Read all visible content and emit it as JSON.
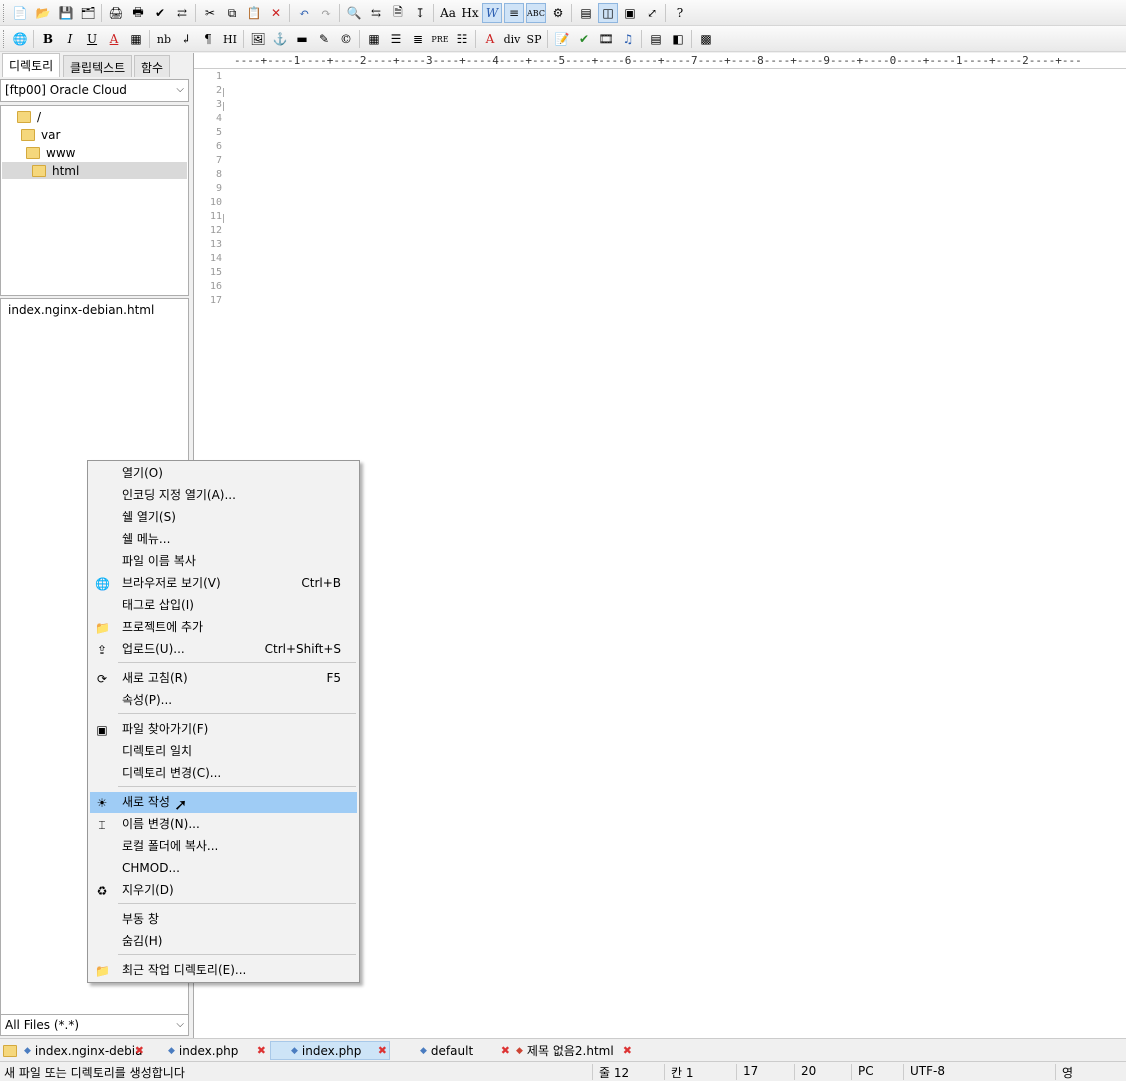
{
  "left_panel": {
    "tabs": [
      "디렉토리",
      "클립텍스트",
      "함수"
    ],
    "server": "[ftp00] Oracle Cloud",
    "tree": [
      {
        "label": "/"
      },
      {
        "label": "var"
      },
      {
        "label": "www"
      },
      {
        "label": "html"
      }
    ],
    "files": [
      "index.nginx-debian.html"
    ],
    "filter": "All Files (*.*)"
  },
  "toolbar2": {
    "nb": "nb",
    "hi": "HI",
    "pre": "PRE",
    "div": "div",
    "sp": "SP",
    "hx": "Hx"
  },
  "editor": {
    "ruler": "----+----1----+----2----+----3----+----4----+----5----+----6----+----7----+----8----+----9----+----0----+----1----+----2----+---",
    "line_numbers": [
      "1",
      "2",
      "3",
      "4",
      "5",
      "6",
      "7",
      "8",
      "9",
      "10",
      "11",
      "12",
      "13",
      "14",
      "15",
      "16",
      "17"
    ]
  },
  "context_menu": {
    "items": [
      {
        "label": "열기(O)",
        "shortcut": "",
        "icon": ""
      },
      {
        "label": "인코딩 지정 열기(A)...",
        "shortcut": "",
        "icon": ""
      },
      {
        "label": "쉘 열기(S)",
        "shortcut": "",
        "icon": ""
      },
      {
        "label": "쉘 메뉴...",
        "shortcut": "",
        "icon": ""
      },
      {
        "label": "파일 이름 복사",
        "shortcut": "",
        "icon": ""
      },
      {
        "label": "브라우저로 보기(V)",
        "shortcut": "Ctrl+B",
        "icon": "globe-icon"
      },
      {
        "label": "태그로 삽입(I)",
        "shortcut": "",
        "icon": ""
      },
      {
        "label": "프로젝트에 추가",
        "shortcut": "",
        "icon": "folder-add-icon"
      },
      {
        "label": "업로드(U)...",
        "shortcut": "Ctrl+Shift+S",
        "icon": "upload-icon"
      },
      {
        "label": "새로 고침(R)",
        "shortcut": "F5",
        "icon": "refresh-icon"
      },
      {
        "label": "속성(P)...",
        "shortcut": "",
        "icon": ""
      },
      {
        "label": "파일 찾아가기(F)",
        "shortcut": "",
        "icon": "find-file-icon"
      },
      {
        "label": "디렉토리 일치",
        "shortcut": "",
        "icon": ""
      },
      {
        "label": "디렉토리 변경(C)...",
        "shortcut": "",
        "icon": ""
      },
      {
        "label": "새로 작성",
        "shortcut": "",
        "icon": "new-sun-icon"
      },
      {
        "label": "이름 변경(N)...",
        "shortcut": "",
        "icon": "rename-icon"
      },
      {
        "label": "로컬 폴더에 복사...",
        "shortcut": "",
        "icon": ""
      },
      {
        "label": "CHMOD...",
        "shortcut": "",
        "icon": ""
      },
      {
        "label": "지우기(D)",
        "shortcut": "",
        "icon": "delete-icon"
      },
      {
        "label": "부동 창",
        "shortcut": "",
        "icon": ""
      },
      {
        "label": "숨김(H)",
        "shortcut": "",
        "icon": ""
      },
      {
        "label": "최근 작업 디렉토리(E)...",
        "shortcut": "",
        "icon": "folder-recent-icon"
      }
    ],
    "highlighted": "새로 작성"
  },
  "doc_tabs": [
    "index.nginx-debia",
    "index.php",
    "index.php",
    "default",
    "제목 없음2.html"
  ],
  "status": {
    "message": "새 파일 또는 디렉토리를 생성합니다",
    "line": "줄 12",
    "col": "칸 1",
    "f1": "17",
    "f2": "20",
    "mode": "PC",
    "encoding": "UTF-8",
    "ime": "영"
  }
}
